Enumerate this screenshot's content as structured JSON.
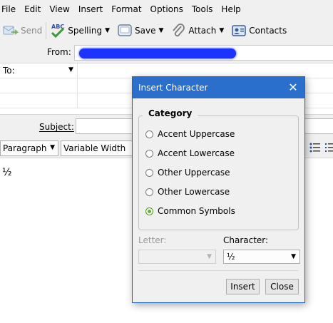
{
  "menubar": {
    "items": [
      "File",
      "Edit",
      "View",
      "Insert",
      "Format",
      "Options",
      "Tools",
      "Help"
    ]
  },
  "toolbar": {
    "send": "Send",
    "spelling": "Spelling",
    "save": "Save",
    "attach": "Attach",
    "contacts": "Contacts"
  },
  "header": {
    "from_label": "From:",
    "to_label": "To:",
    "subject_label": "Subject:"
  },
  "format": {
    "paragraph": "Paragraph",
    "font": "Variable Width"
  },
  "body": {
    "text": "½"
  },
  "dialog": {
    "title": "Insert Character",
    "close_glyph": "✕",
    "category_label": "Category",
    "categories": [
      "Accent Uppercase",
      "Accent Lowercase",
      "Other Uppercase",
      "Other Lowercase",
      "Common Symbols"
    ],
    "selected_category": "Common Symbols",
    "letter_label": "Letter:",
    "letter_value": "",
    "character_label": "Character:",
    "character_value": "½",
    "insert_button": "Insert",
    "close_button": "Close"
  },
  "colors": {
    "dialog_title_bg": "#2b6fcd",
    "redaction": "#1a33ff",
    "radio_checked": "#6aa84f"
  }
}
